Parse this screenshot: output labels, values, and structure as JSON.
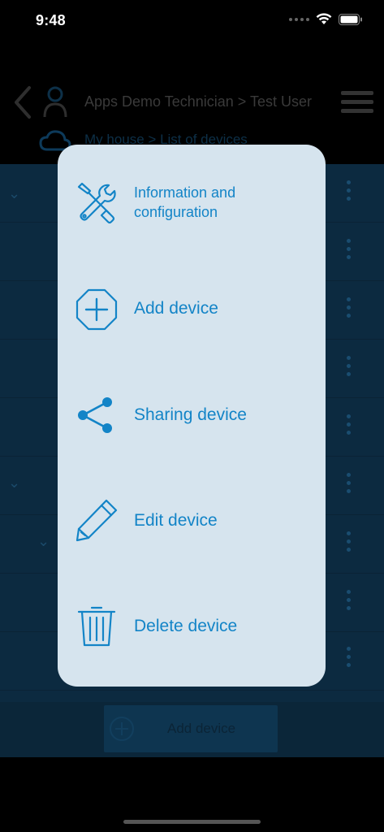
{
  "status_bar": {
    "time": "9:48"
  },
  "background": {
    "breadcrumb": "Apps Demo Technician > Test User",
    "sub_breadcrumb": "My house > List of devices",
    "footer_button_label": "Add device"
  },
  "menu": {
    "items": [
      {
        "label_line1": "Information and",
        "label_line2": "configuration",
        "icon": "tools-icon"
      },
      {
        "label": "Add device",
        "icon": "add-octagon-icon"
      },
      {
        "label": "Sharing device",
        "icon": "share-icon"
      },
      {
        "label": "Edit device",
        "icon": "pencil-icon"
      },
      {
        "label": "Delete device",
        "icon": "trash-icon"
      }
    ]
  },
  "colors": {
    "menu_background": "#d6e4ee",
    "accent": "#1384c7",
    "overlay_list": "#0c2a40"
  }
}
